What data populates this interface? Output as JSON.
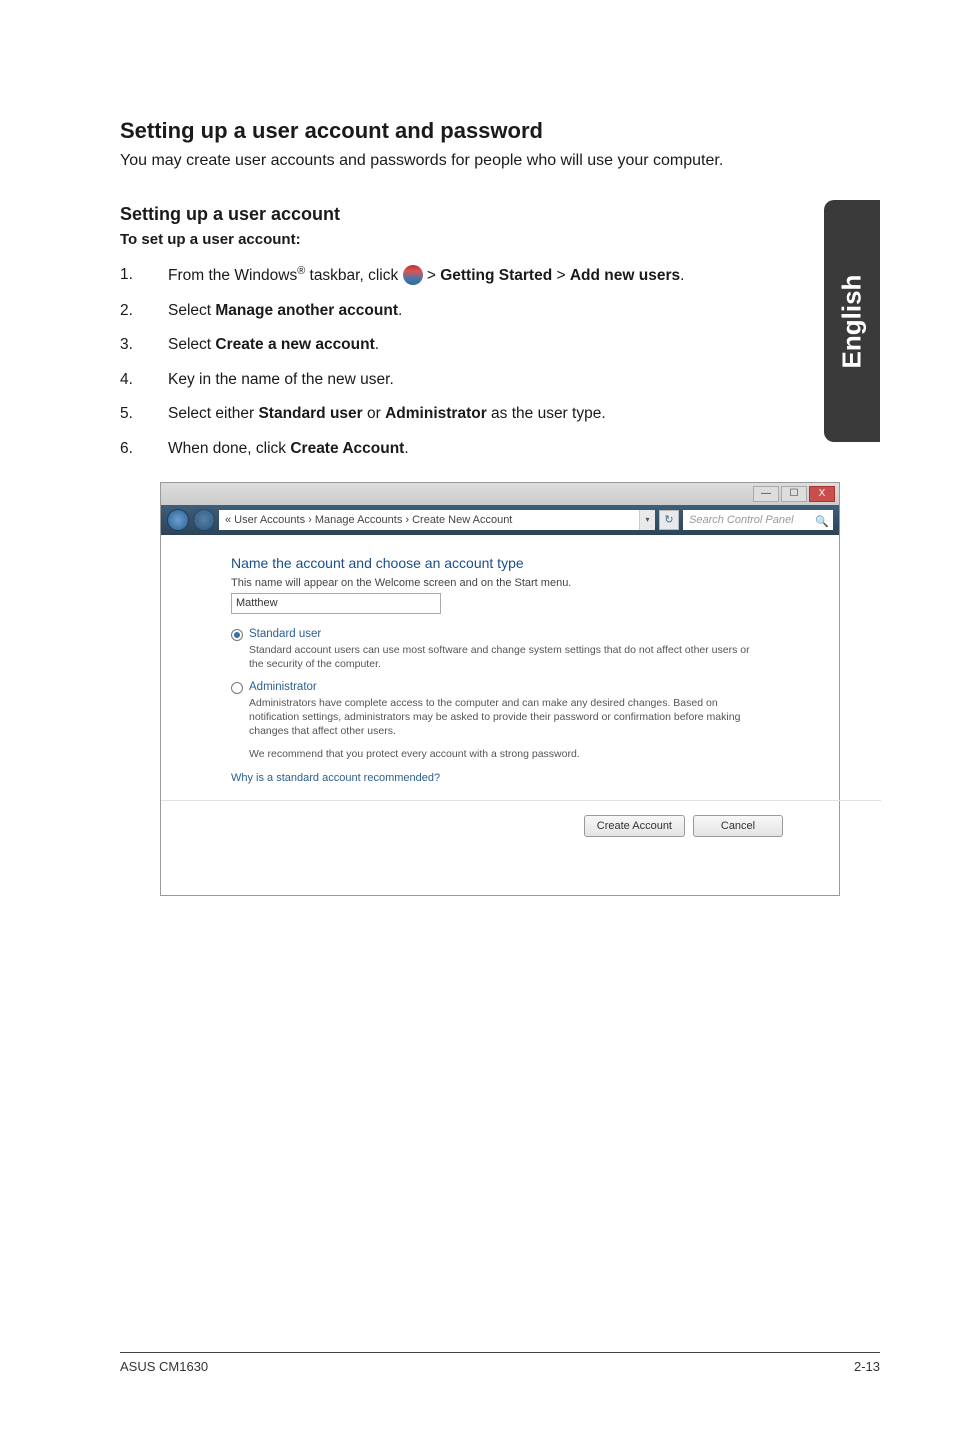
{
  "side_tab": "English",
  "heading_main": "Setting up a user account and password",
  "intro": "You may create user accounts and passwords for people who will use your computer.",
  "heading_sub": "Setting up a user account",
  "sub_caption": "To set up a user account:",
  "steps": {
    "s1_pre": "From the Windows",
    "s1_reg": "®",
    "s1_mid": " taskbar, click ",
    "s1_post": " > ",
    "s1_b1": "Getting Started",
    "s1_sep": " > ",
    "s1_b2": "Add new users",
    "s1_end": ".",
    "s2_a": "Select ",
    "s2_b": "Manage another account",
    "s2_c": ".",
    "s3_a": "Select ",
    "s3_b": "Create a new account",
    "s3_c": ".",
    "s4": "Key in the name of the new user.",
    "s5_a": "Select either ",
    "s5_b": "Standard user",
    "s5_c": " or ",
    "s5_d": "Administrator",
    "s5_e": " as the user type.",
    "s6_a": "When done, click ",
    "s6_b": "Create Account",
    "s6_c": "."
  },
  "embedded": {
    "chrome_min": "—",
    "chrome_max": "☐",
    "chrome_close": "X",
    "breadcrumb": "« User Accounts › Manage Accounts › Create New Account",
    "addr_drop": "▾",
    "refresh": "↻",
    "search_placeholder": "Search Control Panel",
    "search_icon": "🔍",
    "title": "Name the account and choose an account type",
    "sub": "This name will appear on the Welcome screen and on the Start menu.",
    "input_value": "Matthew",
    "r1_label": "Standard user",
    "r1_desc": "Standard account users can use most software and change system settings that do not affect other users or the security of the computer.",
    "r2_label": "Administrator",
    "r2_desc": "Administrators have complete access to the computer and can make any desired changes. Based on notification settings, administrators may be asked to provide their password or confirmation before making changes that affect other users.",
    "recommend": "We recommend that you protect every account with a strong password.",
    "link": "Why is a standard account recommended?",
    "btn_create": "Create Account",
    "btn_cancel": "Cancel"
  },
  "footer": {
    "left": "ASUS CM1630",
    "right": "2-13"
  }
}
